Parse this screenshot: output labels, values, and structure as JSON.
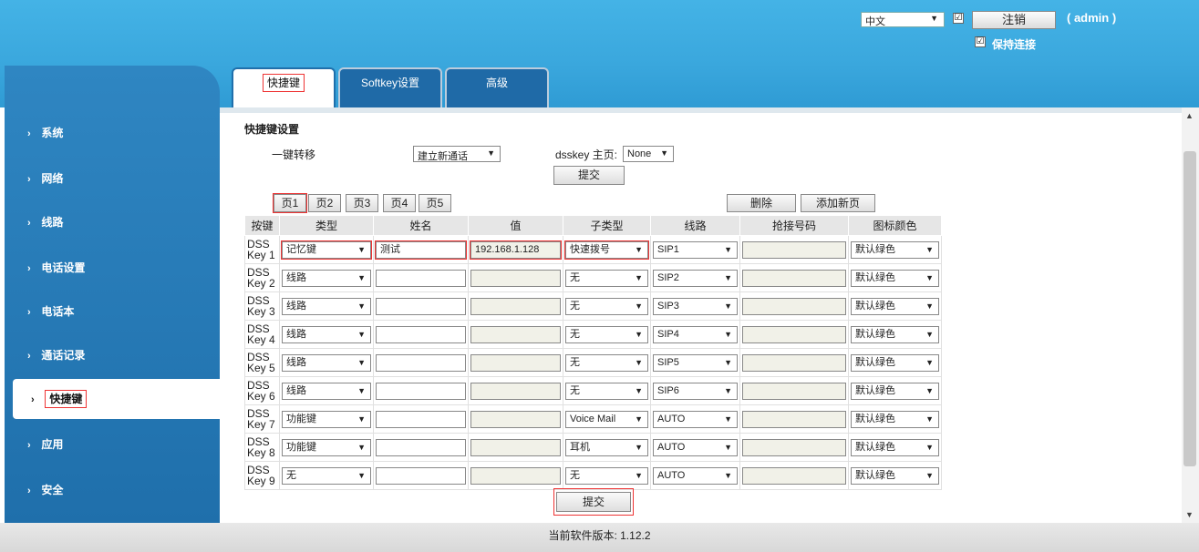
{
  "header": {
    "language": "中文",
    "logout_label": "注销",
    "user_label": "( admin )",
    "keep_connected_label": "保持连接",
    "check_mark": "☑"
  },
  "sidebar": {
    "items": [
      {
        "label": "系统"
      },
      {
        "label": "网络"
      },
      {
        "label": "线路"
      },
      {
        "label": "电话设置"
      },
      {
        "label": "电话本"
      },
      {
        "label": "通话记录"
      },
      {
        "label": "快捷键"
      },
      {
        "label": "应用"
      },
      {
        "label": "安全"
      }
    ]
  },
  "tabs": [
    {
      "label": "快捷键"
    },
    {
      "label": "Softkey设置"
    },
    {
      "label": "高级"
    }
  ],
  "settings": {
    "title": "快捷键设置",
    "transfer_label": "一键转移",
    "transfer_value": "建立新通话",
    "dsskey_home_label": "dsskey 主页:",
    "dsskey_home_value": "None",
    "submit_label": "提交"
  },
  "pages": {
    "buttons": [
      "页1",
      "页2",
      "页3",
      "页4",
      "页5"
    ],
    "delete_label": "删除",
    "add_page_label": "添加新页"
  },
  "table": {
    "headers": [
      "按键",
      "类型",
      "姓名",
      "值",
      "子类型",
      "线路",
      "抢接号码",
      "图标颜色"
    ],
    "rows": [
      {
        "key_line1": "DSS",
        "key_line2": "Key 1",
        "type": "记忆键",
        "name": "测试",
        "value": "192.168.1.128",
        "subtype": "快速拨号",
        "line": "SIP1",
        "pickup": "",
        "color": "默认绿色"
      },
      {
        "key_line1": "DSS",
        "key_line2": "Key 2",
        "type": "线路",
        "name": "",
        "value": "",
        "subtype": "无",
        "line": "SIP2",
        "pickup": "",
        "color": "默认绿色"
      },
      {
        "key_line1": "DSS",
        "key_line2": "Key 3",
        "type": "线路",
        "name": "",
        "value": "",
        "subtype": "无",
        "line": "SIP3",
        "pickup": "",
        "color": "默认绿色"
      },
      {
        "key_line1": "DSS",
        "key_line2": "Key 4",
        "type": "线路",
        "name": "",
        "value": "",
        "subtype": "无",
        "line": "SIP4",
        "pickup": "",
        "color": "默认绿色"
      },
      {
        "key_line1": "DSS",
        "key_line2": "Key 5",
        "type": "线路",
        "name": "",
        "value": "",
        "subtype": "无",
        "line": "SIP5",
        "pickup": "",
        "color": "默认绿色"
      },
      {
        "key_line1": "DSS",
        "key_line2": "Key 6",
        "type": "线路",
        "name": "",
        "value": "",
        "subtype": "无",
        "line": "SIP6",
        "pickup": "",
        "color": "默认绿色"
      },
      {
        "key_line1": "DSS",
        "key_line2": "Key 7",
        "type": "功能键",
        "name": "",
        "value": "",
        "subtype": "Voice Mail",
        "line": "AUTO",
        "pickup": "",
        "color": "默认绿色"
      },
      {
        "key_line1": "DSS",
        "key_line2": "Key 8",
        "type": "功能键",
        "name": "",
        "value": "",
        "subtype": "耳机",
        "line": "AUTO",
        "pickup": "",
        "color": "默认绿色"
      },
      {
        "key_line1": "DSS",
        "key_line2": "Key 9",
        "type": "无",
        "name": "",
        "value": "",
        "subtype": "无",
        "line": "AUTO",
        "pickup": "",
        "color": "默认绿色"
      }
    ]
  },
  "bottom_submit_label": "提交",
  "footer": {
    "version_text": "当前软件版本: 1.12.2"
  },
  "glyphs": {
    "dropdown_arrow": "▼",
    "chevron": "›",
    "scroll_up": "▲",
    "scroll_down": "▼"
  }
}
